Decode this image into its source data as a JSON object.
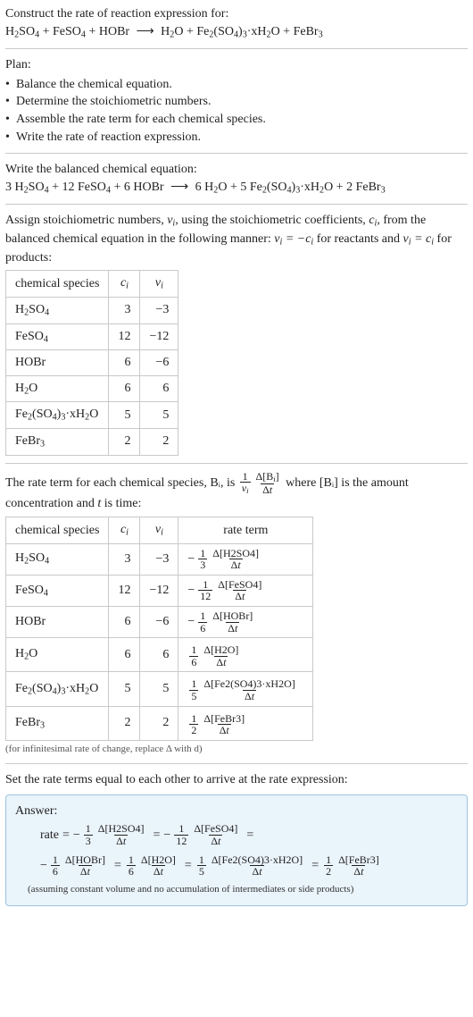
{
  "heading": {
    "title": "Construct the rate of reaction expression for:"
  },
  "equation": {
    "lhs": [
      "H₂SO₄",
      " + ",
      "FeSO₄",
      " + ",
      "HOBr"
    ],
    "rhs": [
      "H₂O",
      " + ",
      "Fe₂(SO₄)₃·xH₂O",
      " + ",
      "FeBr₃"
    ]
  },
  "plan": {
    "label": "Plan:",
    "items": [
      "Balance the chemical equation.",
      "Determine the stoichiometric numbers.",
      "Assemble the rate term for each chemical species.",
      "Write the rate of reaction expression."
    ]
  },
  "balanced": {
    "label": "Write the balanced chemical equation:",
    "lhs": [
      "3 H₂SO₄",
      " + ",
      "12 FeSO₄",
      " + ",
      "6 HOBr"
    ],
    "rhs": [
      "6 H₂O",
      " + ",
      "5 Fe₂(SO₄)₃·xH₂O",
      " + ",
      "2 FeBr₃"
    ]
  },
  "stoich_intro": {
    "line1_a": "Assign stoichiometric numbers, ",
    "line1_b": "νᵢ",
    "line1_c": ", using the stoichiometric coefficients, ",
    "line1_d": "cᵢ",
    "line1_e": ", from the balanced chemical equation in the following manner: ",
    "line1_f": "νᵢ = −cᵢ",
    "line1_g": " for reactants and ",
    "line1_h": "νᵢ = cᵢ",
    "line1_i": " for products:"
  },
  "stoich_table": {
    "headers": {
      "species": "chemical species",
      "ci": "cᵢ",
      "vi": "νᵢ"
    },
    "rows": [
      {
        "species": "H₂SO₄",
        "ci": "3",
        "vi": "−3"
      },
      {
        "species": "FeSO₄",
        "ci": "12",
        "vi": "−12"
      },
      {
        "species": "HOBr",
        "ci": "6",
        "vi": "−6"
      },
      {
        "species": "H₂O",
        "ci": "6",
        "vi": "6"
      },
      {
        "species": "Fe₂(SO₄)₃·xH₂O",
        "ci": "5",
        "vi": "5"
      },
      {
        "species": "FeBr₃",
        "ci": "2",
        "vi": "2"
      }
    ]
  },
  "rate_intro": {
    "a": "The rate term for each chemical species, Bᵢ, is ",
    "num1": "1",
    "den1": "νᵢ",
    "num2": "Δ[Bᵢ]",
    "den2": "Δt",
    "b": " where [Bᵢ] is the amount concentration and ",
    "c": "t",
    "d": " is time:"
  },
  "rate_table": {
    "headers": {
      "species": "chemical species",
      "ci": "cᵢ",
      "vi": "νᵢ",
      "rate": "rate term"
    },
    "rows": [
      {
        "species": "H₂SO₄",
        "ci": "3",
        "vi": "−3",
        "neg": true,
        "f1n": "1",
        "f1d": "3",
        "f2n": "Δ[H2SO4]",
        "f2d": "Δt"
      },
      {
        "species": "FeSO₄",
        "ci": "12",
        "vi": "−12",
        "neg": true,
        "f1n": "1",
        "f1d": "12",
        "f2n": "Δ[FeSO4]",
        "f2d": "Δt"
      },
      {
        "species": "HOBr",
        "ci": "6",
        "vi": "−6",
        "neg": true,
        "f1n": "1",
        "f1d": "6",
        "f2n": "Δ[HOBr]",
        "f2d": "Δt"
      },
      {
        "species": "H₂O",
        "ci": "6",
        "vi": "6",
        "neg": false,
        "f1n": "1",
        "f1d": "6",
        "f2n": "Δ[H2O]",
        "f2d": "Δt"
      },
      {
        "species": "Fe₂(SO₄)₃·xH₂O",
        "ci": "5",
        "vi": "5",
        "neg": false,
        "f1n": "1",
        "f1d": "5",
        "f2n": "Δ[Fe2(SO4)3·xH2O]",
        "f2d": "Δt"
      },
      {
        "species": "FeBr₃",
        "ci": "2",
        "vi": "2",
        "neg": false,
        "f1n": "1",
        "f1d": "2",
        "f2n": "Δ[FeBr3]",
        "f2d": "Δt"
      }
    ],
    "note": "(for infinitesimal rate of change, replace Δ with d)"
  },
  "rate_expr_label": "Set the rate terms equal to each other to arrive at the rate expression:",
  "answer": {
    "label": "Answer:",
    "lead": "rate",
    "terms": [
      {
        "neg": true,
        "f1n": "1",
        "f1d": "3",
        "f2n": "Δ[H2SO4]",
        "f2d": "Δt"
      },
      {
        "neg": true,
        "f1n": "1",
        "f1d": "12",
        "f2n": "Δ[FeSO4]",
        "f2d": "Δt"
      },
      {
        "neg": true,
        "f1n": "1",
        "f1d": "6",
        "f2n": "Δ[HOBr]",
        "f2d": "Δt"
      },
      {
        "neg": false,
        "f1n": "1",
        "f1d": "6",
        "f2n": "Δ[H2O]",
        "f2d": "Δt"
      },
      {
        "neg": false,
        "f1n": "1",
        "f1d": "5",
        "f2n": "Δ[Fe2(SO4)3·xH2O]",
        "f2d": "Δt"
      },
      {
        "neg": false,
        "f1n": "1",
        "f1d": "2",
        "f2n": "Δ[FeBr3]",
        "f2d": "Δt"
      }
    ],
    "note": "(assuming constant volume and no accumulation of intermediates or side products)"
  },
  "chart_data": {
    "type": "table",
    "title": "Stoichiometric numbers and rate terms",
    "tables": [
      {
        "name": "stoichiometric_numbers",
        "columns": [
          "chemical species",
          "c_i",
          "ν_i"
        ],
        "rows": [
          [
            "H2SO4",
            3,
            -3
          ],
          [
            "FeSO4",
            12,
            -12
          ],
          [
            "HOBr",
            6,
            -6
          ],
          [
            "H2O",
            6,
            6
          ],
          [
            "Fe2(SO4)3·xH2O",
            5,
            5
          ],
          [
            "FeBr3",
            2,
            2
          ]
        ]
      },
      {
        "name": "rate_terms",
        "columns": [
          "chemical species",
          "c_i",
          "ν_i",
          "rate term"
        ],
        "rows": [
          [
            "H2SO4",
            3,
            -3,
            "-(1/3) Δ[H2SO4]/Δt"
          ],
          [
            "FeSO4",
            12,
            -12,
            "-(1/12) Δ[FeSO4]/Δt"
          ],
          [
            "HOBr",
            6,
            -6,
            "-(1/6) Δ[HOBr]/Δt"
          ],
          [
            "H2O",
            6,
            6,
            "(1/6) Δ[H2O]/Δt"
          ],
          [
            "Fe2(SO4)3·xH2O",
            5,
            5,
            "(1/5) Δ[Fe2(SO4)3·xH2O]/Δt"
          ],
          [
            "FeBr3",
            2,
            2,
            "(1/2) Δ[FeBr3]/Δt"
          ]
        ]
      }
    ]
  }
}
